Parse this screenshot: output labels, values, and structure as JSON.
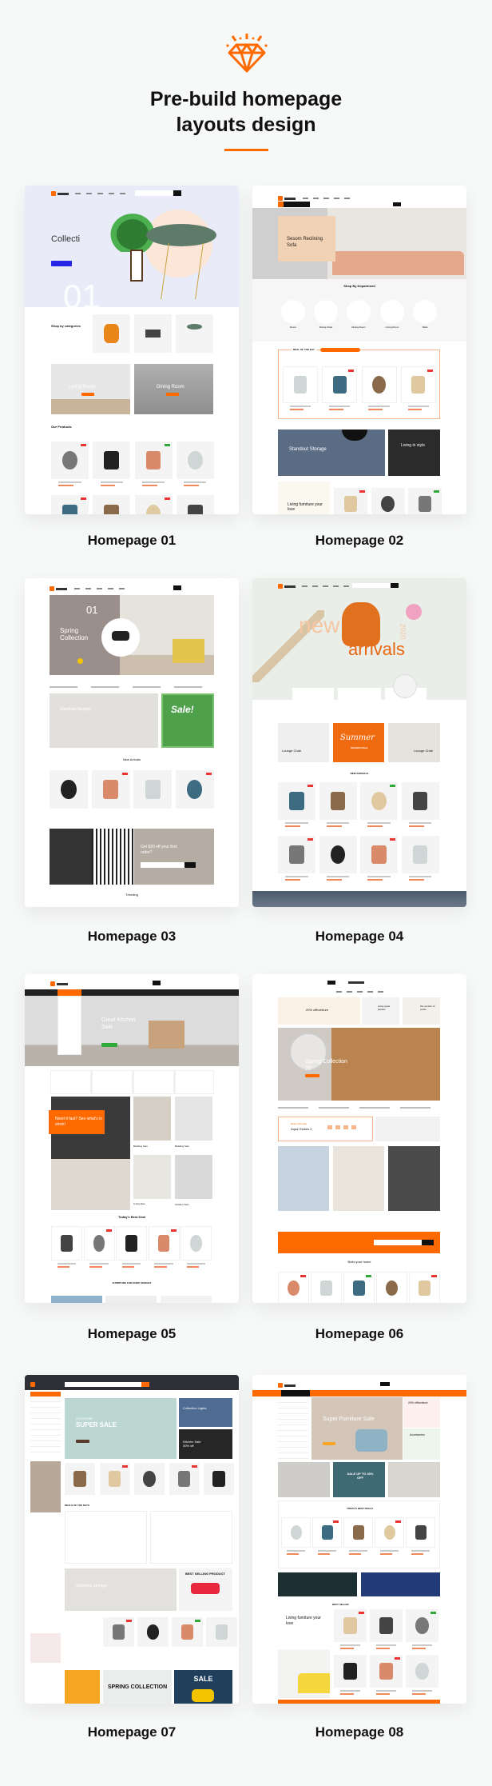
{
  "header": {
    "icon": "diamond-icon",
    "title_line1": "Pre-build homepage",
    "title_line2": "layouts design"
  },
  "colors": {
    "accent": "#ff6a00",
    "background": "#f7f8f8"
  },
  "layouts": [
    {
      "label": "Homepage 01",
      "hero_text": "Collecti",
      "hero_big": "01",
      "section1": "Shop by categories",
      "room1": "Living Room",
      "room2": "Dining Room",
      "section2": "Our Products"
    },
    {
      "label": "Homepage 02",
      "hero_text": "Sesom Reclining Sofa",
      "section1": "Shop By Department",
      "departments": [
        "Decor",
        "Dining Chair",
        "Dining Room",
        "Living Room",
        "Table"
      ],
      "deal": "DEAL OF THE DAY",
      "banner1": "Standout Storage",
      "banner2": "Living in style",
      "promo": "Living furniture your love"
    },
    {
      "label": "Homepage 03",
      "hero_big": "01",
      "hero_text": "Spring Collection",
      "banner1": "Standout Storage",
      "sale": "Sale!",
      "section1": "New Arrivals",
      "promo": "Get $20 off your first order?",
      "section2": "Trending"
    },
    {
      "label": "Homepage 04",
      "hero_word1": "new",
      "hero_word2": "arrivals",
      "hero_year": "2020",
      "banner1": "Lounge Chair",
      "banner2": "Summer",
      "banner2_sub": "SEASON SALE",
      "banner3": "Lounge Chair",
      "section1": "NEW ARRIVALS"
    },
    {
      "label": "Homepage 05",
      "hero_text": "Great Kitchen Sale",
      "promo": "Need it fast? See what's in stock!",
      "tiles": [
        "Bedding Sets",
        "Bedding Sets",
        "Living Sets",
        "Outdoor Sets"
      ],
      "section1": "Today's Best Deal",
      "section2": "FURNITURE FOR EVERY BUDGET"
    },
    {
      "label": "Homepage 06",
      "top1": "20% offfurniture",
      "top2": "pretty great plantes",
      "top3": "the comfort of socks",
      "hero_text": "Spring Collection 20",
      "deal": "Deal of the day",
      "deal_item": "Aqua Globes 2",
      "section1": "Build your home"
    },
    {
      "label": "Homepage 07",
      "hero_small": "OUTDOOR",
      "hero_text": "SUPER SALE",
      "side1": "Collection Lights",
      "side2": "Kitchen Sale 30% off",
      "section1": "DEALS OF THE DAYS",
      "banner1": "Standout Storage",
      "banner2": "BEST SELLING PRODUCT",
      "bottom2": "SPRING COLLECTION",
      "bottom3": "SALE"
    },
    {
      "label": "Homepage 08",
      "hero_text": "Super Furniture Sale",
      "side1": "20% offfurniture",
      "side2": "Accessories",
      "banner2": "SALE UP TO 30% OFF",
      "section1": "TODAY'S BEST DEALS",
      "promo": "Living furniture your love",
      "section2": "BEST SELLER"
    }
  ]
}
